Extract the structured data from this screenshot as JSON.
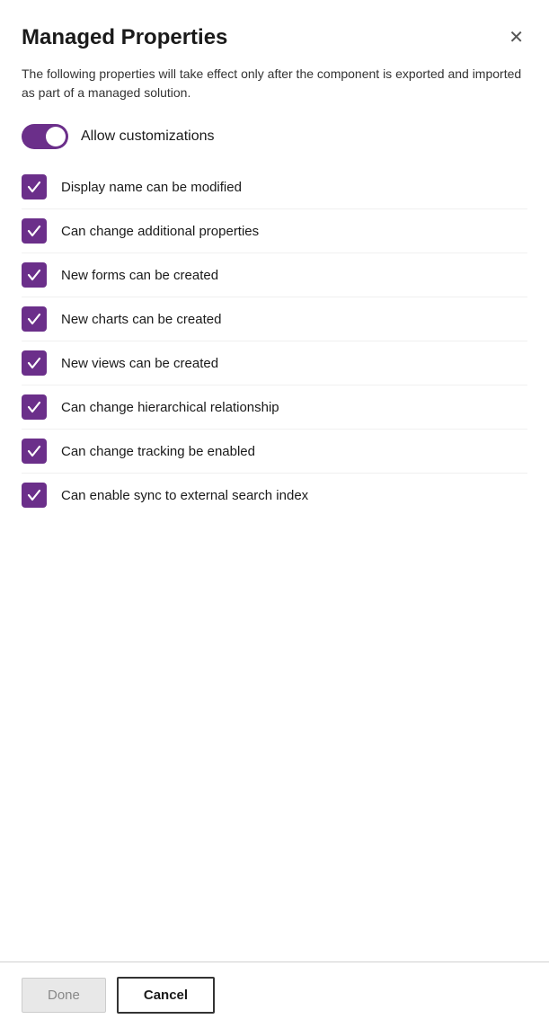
{
  "dialog": {
    "title": "Managed Properties",
    "description": "The following properties will take effect only after the component is exported and imported as part of a managed solution.",
    "close_label": "✕"
  },
  "toggle": {
    "label": "Allow customizations",
    "checked": true
  },
  "checkboxes": [
    {
      "id": "cb1",
      "label": "Display name can be modified",
      "checked": true
    },
    {
      "id": "cb2",
      "label": "Can change additional properties",
      "checked": true
    },
    {
      "id": "cb3",
      "label": "New forms can be created",
      "checked": true
    },
    {
      "id": "cb4",
      "label": "New charts can be created",
      "checked": true
    },
    {
      "id": "cb5",
      "label": "New views can be created",
      "checked": true
    },
    {
      "id": "cb6",
      "label": "Can change hierarchical relationship",
      "checked": true
    },
    {
      "id": "cb7",
      "label": "Can change tracking be enabled",
      "checked": true
    },
    {
      "id": "cb8",
      "label": "Can enable sync to external search index",
      "checked": true
    }
  ],
  "footer": {
    "done_label": "Done",
    "cancel_label": "Cancel"
  }
}
